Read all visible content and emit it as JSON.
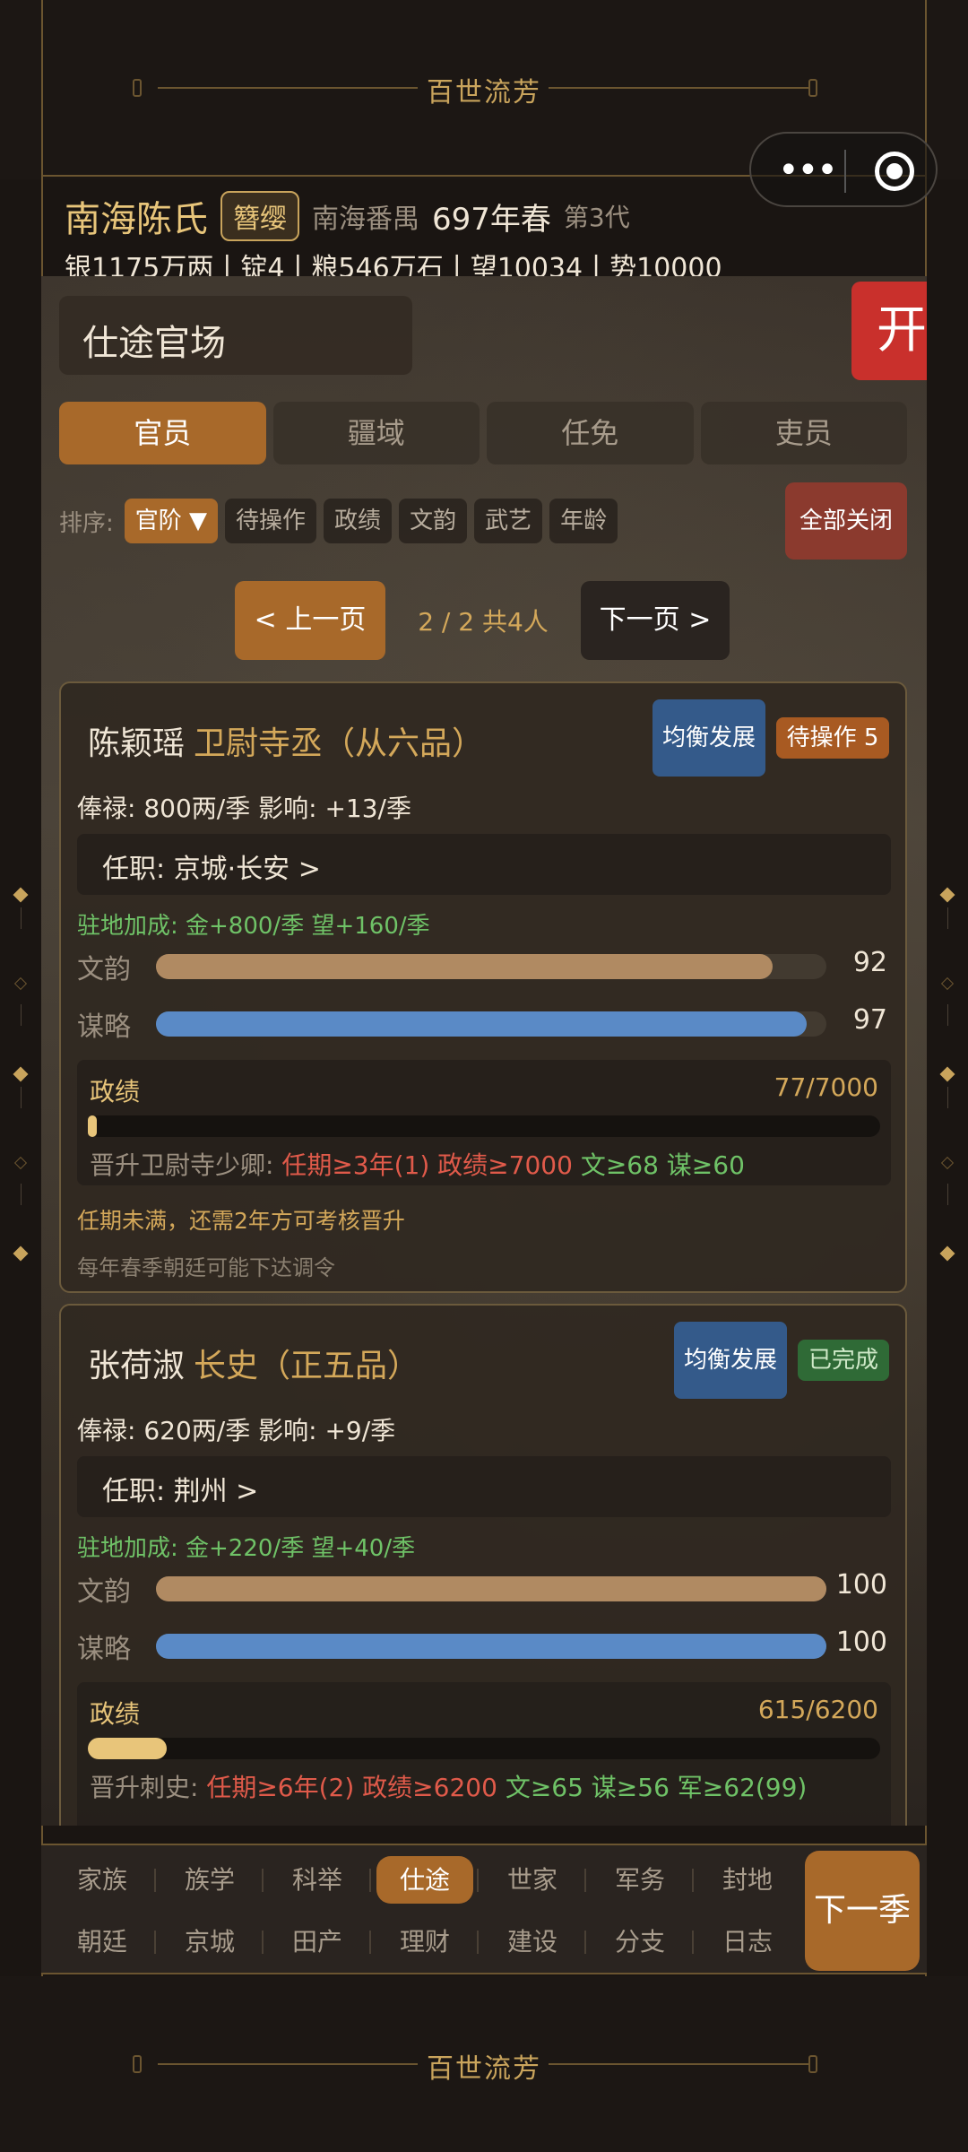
{
  "banner": {
    "title": "百世流芳"
  },
  "footer_banner": {
    "title": "百世流芳"
  },
  "clan": {
    "name": "南海陈氏",
    "tag": "簪缨",
    "place": "南海番禺",
    "year": "697年春",
    "generation": "第3代",
    "resources": "银1175万两丨锭4丨粮546万石丨望10034丨势10000"
  },
  "capsule": {
    "more_icon": "more-dots-icon",
    "close_icon": "target-icon"
  },
  "section": {
    "title": "仕途官场",
    "open_label": "开"
  },
  "tabs": [
    {
      "label": "官员",
      "active": true
    },
    {
      "label": "疆域",
      "active": false
    },
    {
      "label": "任免",
      "active": false
    },
    {
      "label": "吏员",
      "active": false
    }
  ],
  "sort": {
    "label": "排序:",
    "options": [
      "官阶 ▼",
      "待操作",
      "政绩",
      "文韵",
      "武艺",
      "年龄"
    ],
    "close_all": "全部关闭"
  },
  "pager": {
    "prev": "< 上一页",
    "info": "2 / 2  共4人",
    "next": "下一页 >"
  },
  "officials": [
    {
      "name": "陈颖瑶",
      "rank": "卫尉寺丞（从六品）",
      "development": "均衡发展",
      "status": "待操作 5",
      "salary": "俸禄: 800两/季   影响: +13/季",
      "post": "任职: 京城·长安  >",
      "bonus": "驻地加成: 金+800/季  望+160/季",
      "wen_label": "文韵",
      "wen": 92,
      "mou_label": "谋略",
      "mou": 97,
      "perf_label": "政绩",
      "perf_text": "77/7000",
      "perf_current": 77,
      "perf_target": 7000,
      "promo_prefix": "晋升卫尉寺少卿:",
      "promo_red": "任期≥3年(1)  政绩≥7000",
      "promo_green": "文≥68  谋≥60",
      "note1": "任期未满，还需2年方可考核晋升",
      "note2": "每年春季朝廷可能下达调令"
    },
    {
      "name": "张荷淑",
      "rank": "长史（正五品）",
      "development": "均衡发展",
      "status": "已完成",
      "salary": "俸禄: 620两/季   影响: +9/季",
      "post": "任职: 荆州  >",
      "bonus": "驻地加成: 金+220/季  望+40/季",
      "wen_label": "文韵",
      "wen": 100,
      "mou_label": "谋略",
      "mou": 100,
      "perf_label": "政绩",
      "perf_text": "615/6200",
      "perf_current": 615,
      "perf_target": 6200,
      "promo_prefix": "晋升刺史:",
      "promo_red": "任期≥6年(2)  政绩≥6200",
      "promo_green": "文≥65  谋≥56  军≥62(99)"
    }
  ],
  "nav": {
    "row1": [
      "家族",
      "族学",
      "科举",
      "仕途",
      "世家",
      "军务",
      "封地"
    ],
    "row2": [
      "朝廷",
      "京城",
      "田产",
      "理财",
      "建设",
      "分支",
      "日志"
    ],
    "active": "仕途",
    "next_season": "下一季"
  },
  "colors": {
    "accent": "#a8692a",
    "gold": "#d4a85a",
    "red_button": "#c9302c",
    "blue_bar": "#5a8ac6",
    "tan_bar": "#b08a62"
  }
}
